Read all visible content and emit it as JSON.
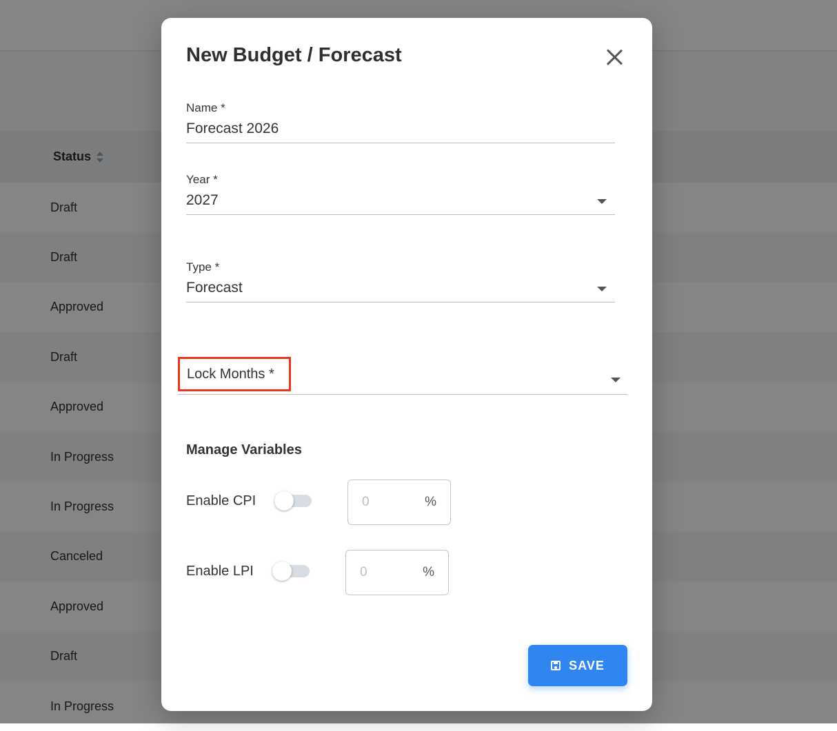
{
  "background": {
    "table_header": {
      "status": "Status"
    },
    "rows": [
      "Draft",
      "Draft",
      "Approved",
      "Draft",
      "Approved",
      "In Progress",
      "In Progress",
      "Canceled",
      "Approved",
      "Draft",
      "In Progress"
    ],
    "fragment": "7"
  },
  "modal": {
    "title": "New Budget / Forecast",
    "fields": {
      "name": {
        "label": "Name *",
        "value": "Forecast 2026"
      },
      "year": {
        "label": "Year *",
        "value": "2027"
      },
      "type": {
        "label": "Type *",
        "value": "Forecast"
      },
      "lock_months": {
        "label": "Lock Months *",
        "value": ""
      }
    },
    "variables": {
      "title": "Manage Variables",
      "cpi": {
        "label": "Enable CPI",
        "placeholder": "0",
        "unit": "%",
        "enabled": false
      },
      "lpi": {
        "label": "Enable LPI",
        "placeholder": "0",
        "unit": "%",
        "enabled": false
      }
    },
    "save_label": "SAVE",
    "colors": {
      "primary": "#2f86f0",
      "highlight": "#e8361e"
    }
  }
}
